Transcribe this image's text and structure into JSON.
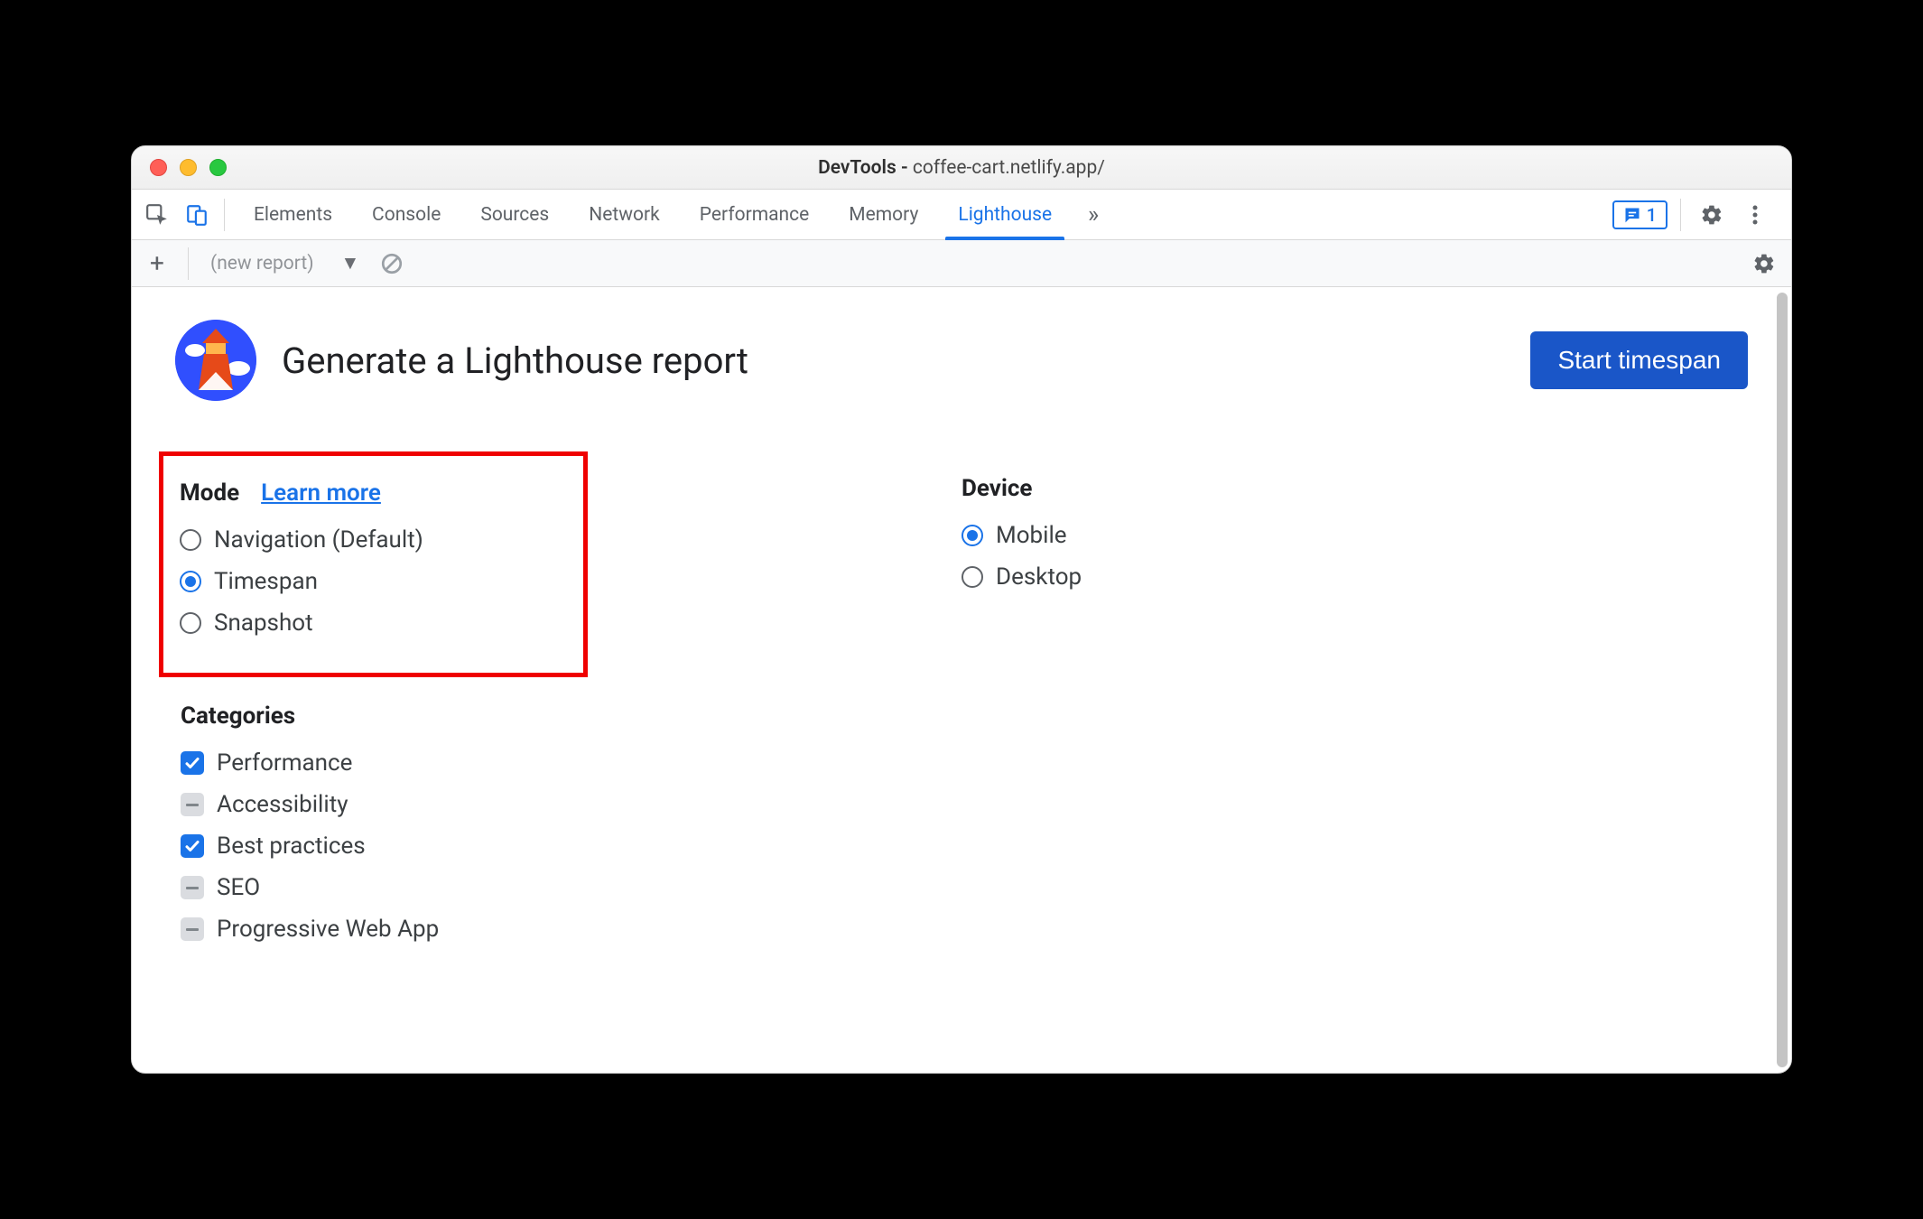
{
  "window": {
    "title_prefix": "DevTools - ",
    "title_path": "coffee-cart.netlify.app/"
  },
  "tabs": {
    "items": [
      "Elements",
      "Console",
      "Sources",
      "Network",
      "Performance",
      "Memory",
      "Lighthouse"
    ],
    "active": "Lighthouse",
    "msg_count": "1"
  },
  "toolbar": {
    "report_label": "(new report)"
  },
  "main": {
    "heading": "Generate a Lighthouse report",
    "start_button": "Start timespan"
  },
  "mode": {
    "title": "Mode",
    "learn_more": "Learn more",
    "options": [
      {
        "label": "Navigation (Default)",
        "checked": false
      },
      {
        "label": "Timespan",
        "checked": true
      },
      {
        "label": "Snapshot",
        "checked": false
      }
    ]
  },
  "device": {
    "title": "Device",
    "options": [
      {
        "label": "Mobile",
        "checked": true
      },
      {
        "label": "Desktop",
        "checked": false
      }
    ]
  },
  "categories": {
    "title": "Categories",
    "items": [
      {
        "label": "Performance",
        "state": "checked"
      },
      {
        "label": "Accessibility",
        "state": "indeterminate"
      },
      {
        "label": "Best practices",
        "state": "checked"
      },
      {
        "label": "SEO",
        "state": "indeterminate"
      },
      {
        "label": "Progressive Web App",
        "state": "indeterminate"
      }
    ]
  },
  "colors": {
    "accent": "#1a73e8",
    "highlight_border": "#ef0000",
    "primary_button": "#1a56c8"
  }
}
